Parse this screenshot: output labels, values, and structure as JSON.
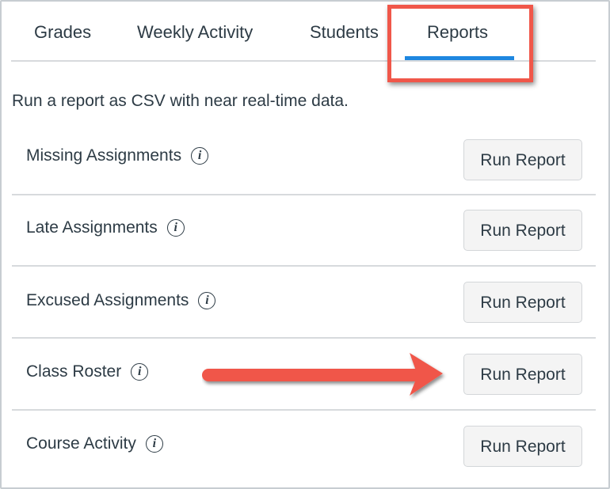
{
  "tabs": [
    {
      "label": "Grades",
      "active": false
    },
    {
      "label": "Weekly Activity",
      "active": false
    },
    {
      "label": "Students",
      "active": false
    },
    {
      "label": "Reports",
      "active": true
    }
  ],
  "colors": {
    "accent": "#1e87e0",
    "annotation": "#f0574a",
    "text": "#2d3b45"
  },
  "description": "Run a report as CSV with near real-time data.",
  "reports": [
    {
      "label": "Missing Assignments",
      "icon": "info-icon",
      "button": "Run Report"
    },
    {
      "label": "Late Assignments",
      "icon": "info-icon",
      "button": "Run Report"
    },
    {
      "label": "Excused Assignments",
      "icon": "info-icon",
      "button": "Run Report"
    },
    {
      "label": "Class Roster",
      "icon": "info-icon",
      "button": "Run Report"
    },
    {
      "label": "Course Activity",
      "icon": "info-icon",
      "button": "Run Report"
    }
  ],
  "info_glyph": "i"
}
